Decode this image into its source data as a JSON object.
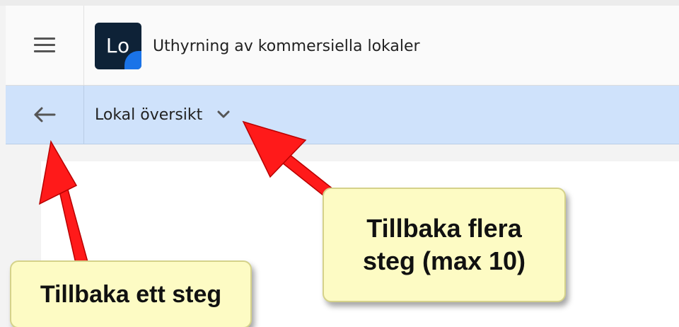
{
  "app": {
    "logo_text": "Lo",
    "title": "Uthyrning av kommersiella lokaler"
  },
  "nav": {
    "current_page": "Lokal översikt"
  },
  "annotations": {
    "back_one_step": "Tillbaka ett steg",
    "back_several_steps_line1": "Tillbaka flera",
    "back_several_steps_line2": "steg (max 10)"
  },
  "colors": {
    "nav_bar": "#cfe2fb",
    "logo_bg": "#0e2237",
    "logo_accent": "#1a73e8",
    "arrow": "#ff1a1a",
    "callout_bg": "#fdfbc4"
  },
  "icons": {
    "menu": "hamburger-menu-icon",
    "back": "arrow-left-icon",
    "dropdown": "chevron-down-icon"
  }
}
